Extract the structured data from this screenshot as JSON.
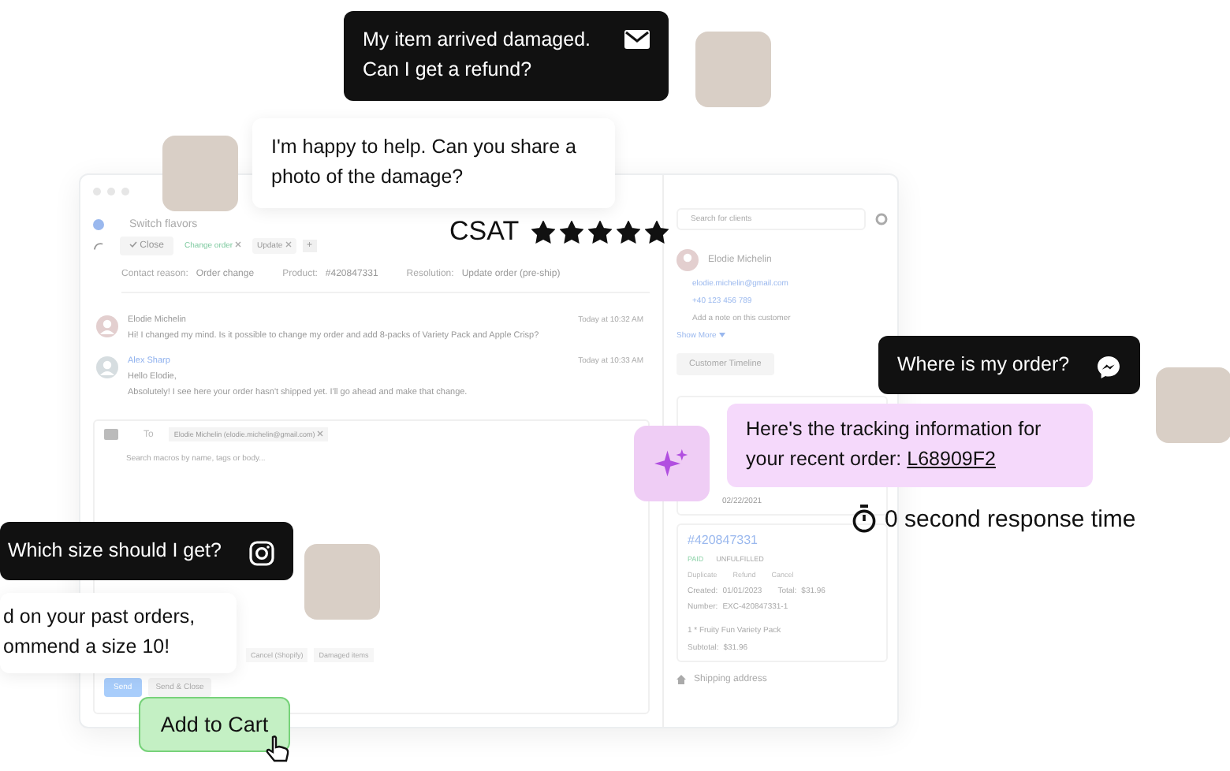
{
  "helpdesk": {
    "ticket": {
      "subject": "Switch flavors",
      "close_button": "Close",
      "tags": [
        "Change order",
        "Update"
      ],
      "add_tag": "+",
      "fields": [
        {
          "label": "Contact reason:",
          "value": "Order change"
        },
        {
          "label": "Product:",
          "value": "#420847331"
        },
        {
          "label": "Resolution:",
          "value": "Update order (pre-ship)"
        }
      ]
    },
    "messages": [
      {
        "kind": "customer",
        "author": "Elodie Michelin",
        "time": "Today at 10:32 AM",
        "body": [
          "Hi! I changed my mind. Is it possible to change my order and add 8-packs of Variety Pack and Apple Crisp?"
        ]
      },
      {
        "kind": "agent",
        "author": "Alex Sharp",
        "time": "Today at 10:33 AM",
        "body": [
          "Hello Elodie,",
          "Absolutely! I see here your order hasn't shipped yet. I'll go ahead and make that change."
        ]
      }
    ],
    "reply": {
      "to_label": "To",
      "recipient": "Elodie Michelin (elodie.michelin@gmail.com)",
      "macro_placeholder": "Search macros by name, tags or body...",
      "macros": [
        "Cancel (Shopify)",
        "Damaged items"
      ],
      "send": "Send",
      "send_close": "Send & Close"
    },
    "sidebar": {
      "search_placeholder": "Search for clients",
      "customer": {
        "name": "Elodie Michelin",
        "email": "elodie.michelin@gmail.com",
        "phone": "+40 123 456 789",
        "note_placeholder": "Add a note on this customer",
        "show_more": "Show More"
      },
      "timeline_button": "Customer Timeline",
      "store_created": "02/22/2021",
      "order": {
        "number": "#420847331",
        "statuses": [
          "PAID",
          "UNFULFILLED"
        ],
        "actions": [
          "Duplicate",
          "Refund",
          "Cancel"
        ],
        "details": [
          {
            "label": "Created:",
            "value": "01/01/2023"
          },
          {
            "label": "Total:",
            "value": "$31.96"
          },
          {
            "label": "Number:",
            "value": "EXC-420847331-1"
          }
        ],
        "item": "1 * Fruity Fun Variety Pack",
        "subtotal_label": "Subtotal:",
        "subtotal": "$31.96"
      },
      "shipping": "Shipping address"
    }
  },
  "bubbles": [
    {
      "kind": "customer",
      "text": "My item arrived damaged. Can I get a refund?",
      "channel": {
        "kind": "email"
      }
    },
    {
      "kind": "agent",
      "text": "I'm happy to help. Can you share a photo of the damage?"
    },
    {
      "kind": "customer",
      "text": "Where is my order?",
      "channel": {
        "kind": "messenger"
      }
    },
    {
      "kind": "ai",
      "text": "Here's the tracking information for your recent order:",
      "link": "L68909F2"
    },
    {
      "kind": "customer",
      "text": "Which size should I get?",
      "channel": {
        "kind": "instagram"
      }
    },
    {
      "kind": "agent",
      "text": "d on your past orders, ommend a size 10!"
    }
  ],
  "csat": {
    "label": "CSAT",
    "stars": 5
  },
  "response_time": "0 second response time",
  "add_to_cart": "Add to Cart"
}
